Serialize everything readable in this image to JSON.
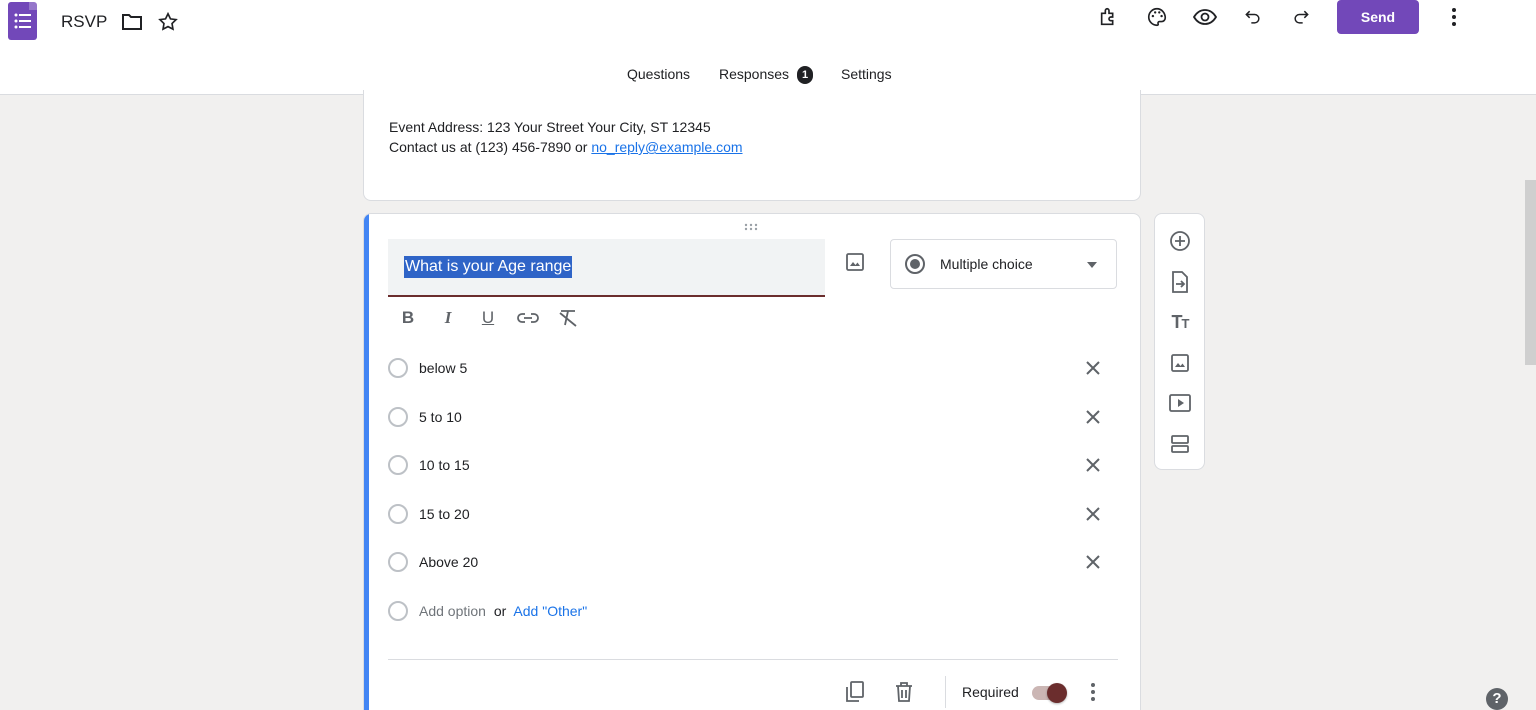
{
  "header": {
    "title": "RSVP",
    "send_label": "Send",
    "icons": [
      "folder-icon",
      "star-icon",
      "addons-icon",
      "palette-icon",
      "preview-icon",
      "undo-icon",
      "redo-icon",
      "more-vert-icon"
    ]
  },
  "tabs": {
    "questions": "Questions",
    "responses": "Responses",
    "responses_badge": "1",
    "settings": "Settings"
  },
  "description": {
    "address_line": "Event Address: 123 Your Street Your City, ST 12345",
    "contact_prefix": "Contact us at (123) 456-7890 or ",
    "contact_email": "no_reply@example.com"
  },
  "question": {
    "title": "What is your Age range",
    "type": "Multiple choice",
    "options": [
      "below 5",
      "5 to 10",
      "10 to 15",
      "15 to 20",
      "Above 20"
    ],
    "add_option": "Add option",
    "or_text": "or",
    "add_other": "Add \"Other\"",
    "required_label": "Required",
    "required": true
  },
  "colors": {
    "accent": "#7248b9",
    "theme": "#6b2d2d",
    "focus_bar": "#4285f4",
    "link": "#1a73e8"
  },
  "help_label": "?"
}
